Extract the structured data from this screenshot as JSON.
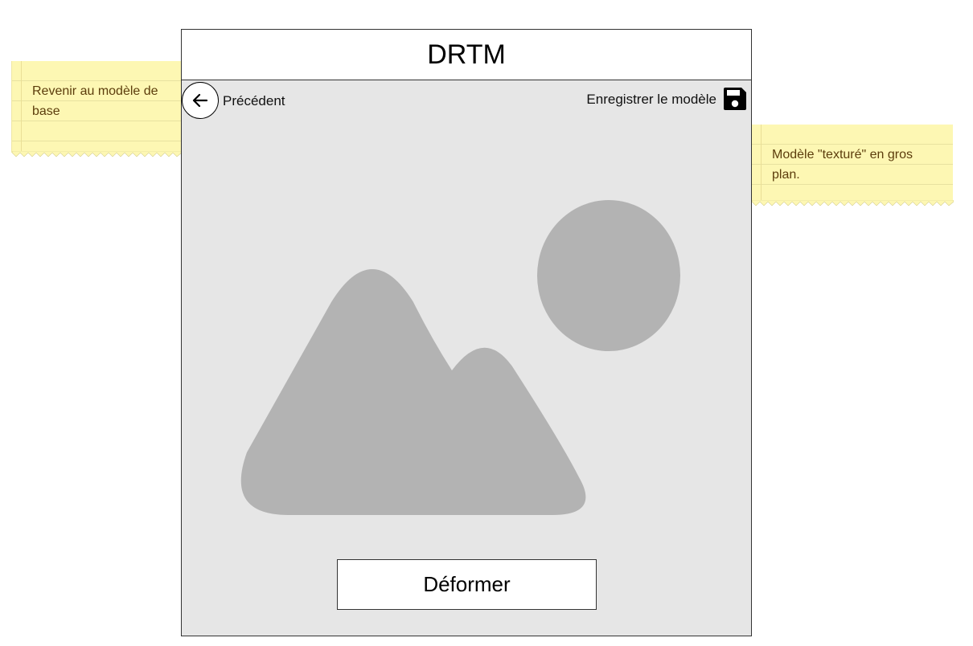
{
  "app": {
    "title": "DRTM"
  },
  "toolbar": {
    "back_label": "Précédent",
    "save_label": "Enregistrer le modèle"
  },
  "main": {
    "image_icon": "image-placeholder-icon",
    "action_label": "Déformer"
  },
  "notes": {
    "left": "Revenir au modèle de base",
    "right": "Modèle \"texturé\" en gros plan."
  },
  "colors": {
    "note_background": "#fdf7b3",
    "note_text": "#5c3d0c",
    "canvas_background": "#e6e6e6",
    "placeholder_gray": "#b3b3b3"
  }
}
